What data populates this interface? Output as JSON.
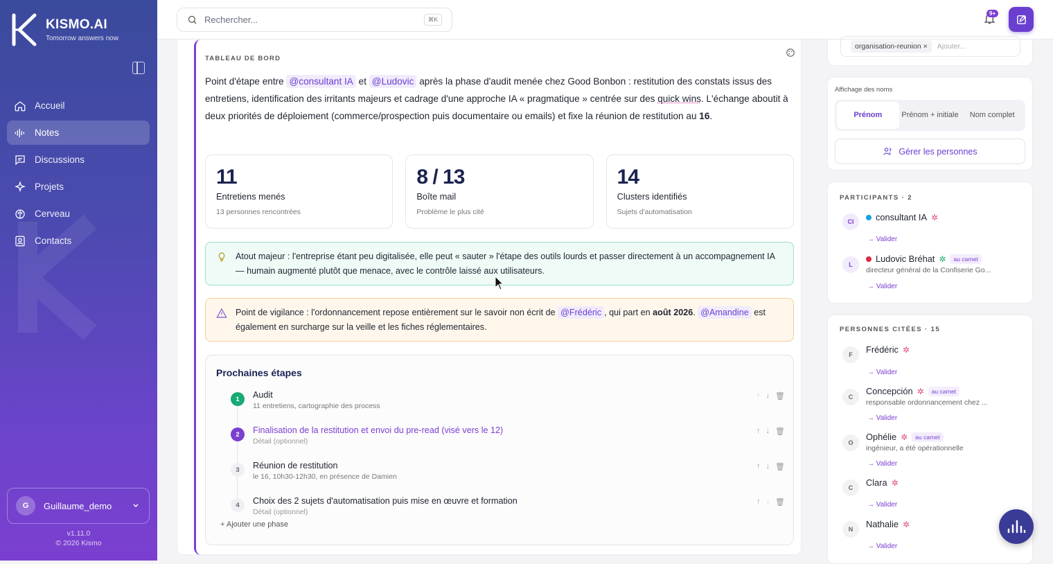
{
  "app": {
    "brand": "KISMO.AI",
    "tagline": "Tomorrow answers now"
  },
  "sidebar": {
    "items": [
      {
        "label": "Accueil",
        "icon": "home-icon"
      },
      {
        "label": "Notes",
        "icon": "waveform-icon"
      },
      {
        "label": "Discussions",
        "icon": "chat-icon"
      },
      {
        "label": "Projets",
        "icon": "sparkles-icon"
      },
      {
        "label": "Cerveau",
        "icon": "brain-icon"
      },
      {
        "label": "Contacts",
        "icon": "contacts-icon"
      }
    ],
    "active": "Notes",
    "user": {
      "initial": "G",
      "name": "Guillaume_demo"
    },
    "version": "v1.11.0",
    "copyright": "© 2026 Kismo"
  },
  "topbar": {
    "search_placeholder": "Rechercher...",
    "shortcut": "⌘K",
    "notif_badge": "9+"
  },
  "dashboard": {
    "label": "TABLEAU DE BORD",
    "summary": {
      "p1": "Point d'étape entre ",
      "m1": "@consultant IA",
      "p2": " et ",
      "m2": "@Ludovic",
      "p3": " après la phase d'audit menée chez Good Bonbon : restitution des constats issus des entretiens, identification des irritants majeurs et cadrage d'une approche IA « pragmatique » centrée sur des ",
      "u1": "quick wins",
      "p4": ". L'échange aboutit à deux priorités de déploiement (commerce/prospection puis documentaire ou emails) et fixe la réunion de restitution au ",
      "b1": "16",
      "p5": "."
    },
    "stats": [
      {
        "value": "11",
        "label": "Entretiens menés",
        "sub": "13 personnes rencontrées"
      },
      {
        "value": "8 / 13",
        "label": "Boîte mail",
        "sub": "Problème le plus cité"
      },
      {
        "value": "14",
        "label": "Clusters identifiés",
        "sub": "Sujets d'automatisation"
      }
    ],
    "strength": "Atout majeur : l'entreprise étant peu digitalisée, elle peut « sauter » l'étape des outils lourds et passer directement à un accompagnement IA — humain augmenté plutôt que menace, avec le contrôle laissé aux utilisateurs.",
    "warning": {
      "p1": "Point de vigilance : l'ordonnancement repose entièrement sur le savoir non écrit de ",
      "m1": "@Frédéric",
      "p2": ", qui part en ",
      "b1": "août 2026",
      "p3": ". ",
      "m2": "@Amandine",
      "p4": " est également en surcharge sur la veille et les fiches réglementaires."
    },
    "next_steps": {
      "title": "Prochaines étapes",
      "steps": [
        {
          "num": "1",
          "title": "Audit",
          "desc": "11 entretiens, cartographie des process",
          "state": "done"
        },
        {
          "num": "2",
          "title": "Finalisation de la restitution et envoi du pre-read (visé vers le 12)",
          "desc": "Détail (optionnel)",
          "state": "current"
        },
        {
          "num": "3",
          "title": "Réunion de restitution",
          "desc": "le 16, 10h30-12h30, en présence de Damien",
          "state": "todo"
        },
        {
          "num": "4",
          "title": "Choix des 2 sujets d'automatisation puis mise en œuvre et formation",
          "desc": "Détail (optionnel)",
          "state": "todo"
        }
      ],
      "add_label": "+ Ajouter une phase"
    }
  },
  "right": {
    "tags": {
      "tag": "organisation-reunion",
      "placeholder": "Ajouter..."
    },
    "names": {
      "title": "Affichage des noms",
      "options": [
        "Prénom",
        "Prénom + initiale",
        "Nom complet"
      ],
      "selected": "Prénom",
      "manage": "Gérer les personnes"
    },
    "participants": {
      "title": "PARTICIPANTS · 2",
      "items": [
        {
          "initials": "CI",
          "name": "consultant IA",
          "dot": "#1aa0e0",
          "role": "",
          "carnet": "",
          "validate": "→ Valider"
        },
        {
          "initials": "L",
          "name": "Ludovic Bréhat",
          "dot": "#e0264a",
          "role": "directeur général de la Confiserie Go...",
          "carnet": "au carnet",
          "validate": "→ Valider"
        }
      ]
    },
    "cited": {
      "title": "PERSONNES CITÉES · 15",
      "items": [
        {
          "initial": "F",
          "name": "Frédéric",
          "role": "",
          "carnet": "",
          "validate": "→ Valider"
        },
        {
          "initial": "C",
          "name": "Concepción",
          "role": "responsable ordonnancement chez ...",
          "carnet": "au carnet",
          "validate": "→ Valider"
        },
        {
          "initial": "O",
          "name": "Ophélie",
          "role": "ingénieur, a été opérationnelle",
          "carnet": "au carnet",
          "validate": "→ Valider"
        },
        {
          "initial": "C",
          "name": "Clara",
          "role": "",
          "carnet": "",
          "validate": "→ Valider"
        },
        {
          "initial": "N",
          "name": "Nathalie",
          "role": "",
          "carnet": "",
          "validate": "→ Valider"
        }
      ]
    }
  },
  "colors": {
    "accent": "#6a3fd0",
    "sidebar_top": "#3a4a9c",
    "sidebar_bottom": "#7b3fd0"
  }
}
